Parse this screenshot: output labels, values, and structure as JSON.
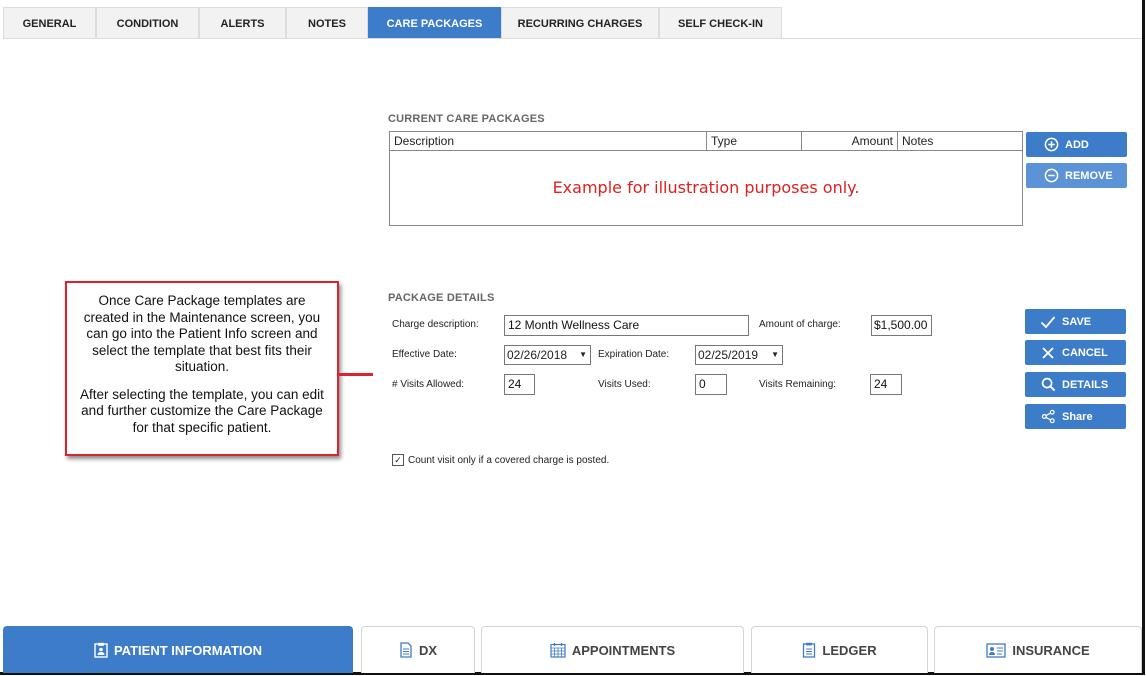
{
  "tabs": [
    "GENERAL",
    "CONDITION",
    "ALERTS",
    "NOTES",
    "CARE PACKAGES",
    "RECURRING CHARGES",
    "SELF CHECK-IN"
  ],
  "current": {
    "title": "CURRENT CARE PACKAGES",
    "columns": [
      "Description",
      "Type",
      "Amount",
      "Notes"
    ],
    "watermark": "Example for illustration purposes only.",
    "add_label": "ADD",
    "remove_label": "REMOVE"
  },
  "details": {
    "title": "PACKAGE DETAILS",
    "charge_description_label": "Charge description:",
    "charge_description": "12 Month Wellness Care",
    "amount_label": "Amount of charge:",
    "amount": "$1,500.00",
    "effective_label": "Effective Date:",
    "effective_date": "02/26/2018",
    "expiration_label": "Expiration Date:",
    "expiration_date": "02/25/2019",
    "visits_allowed_label": "# Visits Allowed:",
    "visits_allowed": "24",
    "visits_used_label": "Visits Used:",
    "visits_used": "0",
    "visits_remaining_label": "Visits Remaining:",
    "visits_remaining": "24",
    "count_visit_label": "Count visit only if a covered charge is posted.",
    "count_visit_checked": true
  },
  "actions": {
    "save": "SAVE",
    "cancel": "CANCEL",
    "details": "DETAILS",
    "share": "Share"
  },
  "note": {
    "p1": "Once Care Package templates are created in the Maintenance screen, you can go into the Patient Info screen and select the template that best fits their situation.",
    "p2": "After selecting the template, you can edit and further customize the Care Package for that specific patient."
  },
  "bottom_nav": {
    "patient_info": "PATIENT INFORMATION",
    "dx": "DX",
    "appointments": "APPOINTMENTS",
    "ledger": "LEDGER",
    "insurance": "INSURANCE"
  },
  "colors": {
    "accent": "#3d7cc9",
    "callout": "#d9232e",
    "watermark": "#e02020"
  }
}
